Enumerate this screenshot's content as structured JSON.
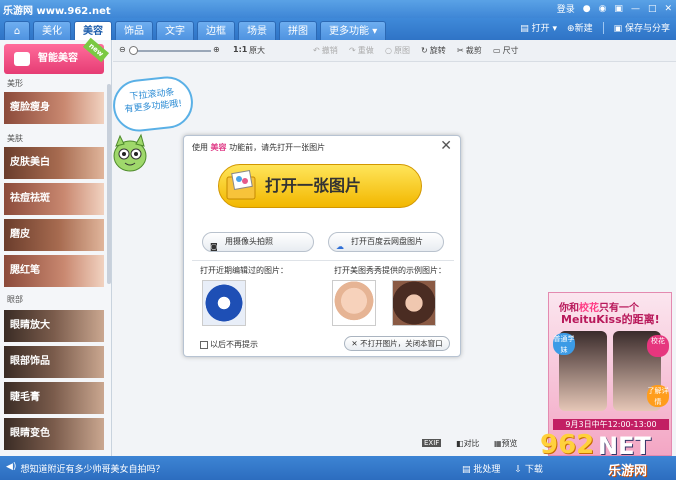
{
  "titlebar": {
    "site": "乐游网 www.962.net",
    "login": "登录"
  },
  "nav": {
    "tabs": [
      {
        "label": "美化"
      },
      {
        "label": "美容"
      },
      {
        "label": "饰品"
      },
      {
        "label": "文字"
      },
      {
        "label": "边框"
      },
      {
        "label": "场景"
      },
      {
        "label": "拼图"
      },
      {
        "label": "更多功能"
      }
    ],
    "open": "打开",
    "new": "新建",
    "save": "保存与分享"
  },
  "sidebar": {
    "smart": "智能美容",
    "new_badge": "new",
    "cat_shape": "美形",
    "cat_skin": "美肤",
    "cat_eye": "眼部",
    "items": [
      "瘦脸瘦身",
      "皮肤美白",
      "祛痘祛斑",
      "磨皮",
      "腮红笔",
      "眼睛放大",
      "眼部饰品",
      "睫毛膏",
      "眼睛变色"
    ]
  },
  "toolbar": {
    "ratio": "1:1",
    "original": "原大",
    "undo": "撤销",
    "redo": "重做",
    "restore": "原图",
    "rotate": "旋转",
    "crop": "裁剪",
    "size": "尺寸"
  },
  "bubble": {
    "line1": "下拉滚动条",
    "line2": "有更多功能哦!"
  },
  "dialog": {
    "title_pre": "使用",
    "title_hl": "美容",
    "title_post": "功能前，请先打开一张图片",
    "open_big": "打开一张图片",
    "camera": "用摄像头拍照",
    "cloud": "打开百度云网盘图片",
    "recent_label": "打开近期编辑过的图片：",
    "sample_label": "打开美图秀秀提供的示例图片：",
    "checkbox": "以后不再提示",
    "no_open": "不打开图片，关闭本窗口"
  },
  "ad": {
    "line1_a": "你和",
    "line1_hl": "校花",
    "line1_b": "只有一个",
    "line2": "MeituKiss的距离!",
    "b1": "普通学妹",
    "b2": "校花",
    "b3": "了解详情",
    "date": "9月3日中午12:00-13:00"
  },
  "bottom": {
    "exif": "EXIF",
    "compare": "对比",
    "preview": "预览"
  },
  "status": {
    "tip": "想知道附近有多少帅哥美女自拍吗？",
    "batch": "批处理",
    "download": "下载"
  },
  "watermark": {
    "num": "962",
    "net": "NET",
    "cn": "乐游网"
  }
}
